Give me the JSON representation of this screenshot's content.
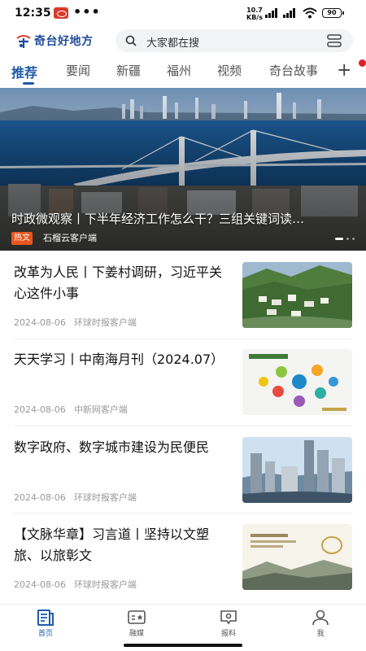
{
  "status_bar": {
    "time": "12:35",
    "dots": "•••",
    "speed_value": "10.7",
    "speed_unit": "KB/s",
    "battery": "90"
  },
  "header": {
    "logo_text": "奇台好地方",
    "search_placeholder": "大家都在搜"
  },
  "tabs": [
    "推荐",
    "要闻",
    "新疆",
    "福州",
    "视频",
    "奇台故事"
  ],
  "tab_plus": "+",
  "hero": {
    "title": "时政微观察丨下半年经济工作怎么干？三组关键词读…",
    "badge": "热文",
    "source": "石榴云客户端"
  },
  "news": [
    {
      "title": "改革为人民丨下姜村调研，习近平关心这件小事",
      "date": "2024-08-06",
      "source": "环球时报客户端"
    },
    {
      "title": "天天学习丨中南海月刊（2024.07）",
      "date": "2024-08-06",
      "source": "中新网客户端"
    },
    {
      "title": "数字政府、数字城市建设为民便民",
      "date": "2024-08-06",
      "source": "环球时报客户端"
    },
    {
      "title": "【文脉华章】习言道丨坚持以文塑旅、以旅彰文",
      "date": "2024-08-06",
      "source": "环球时报客户端"
    }
  ],
  "bottom_nav": [
    "首页",
    "融媒",
    "报料",
    "我"
  ],
  "colors": {
    "accent": "#1f5aa8",
    "hot_badge": "#e8561e",
    "notification_dot": "#e02020"
  }
}
